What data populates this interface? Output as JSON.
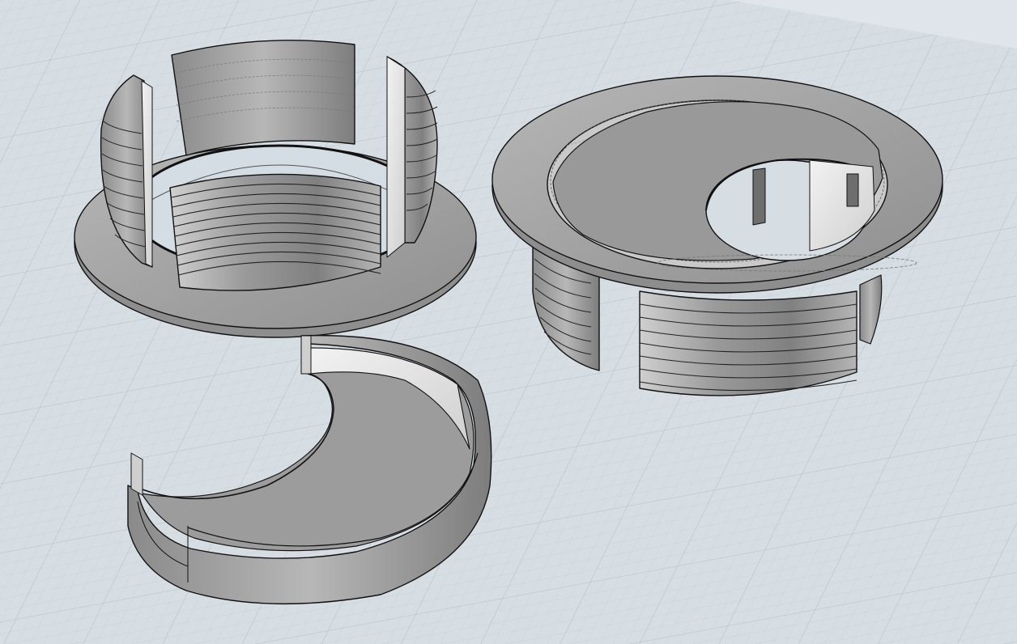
{
  "viewport": {
    "type": "cad-3d-perspective",
    "background": "#d6dee4",
    "grid_color": "#bcc6ce",
    "model_fill_dark": "#6f6f6f",
    "model_fill_mid": "#a3a3a3",
    "model_fill_light": "#e6e6e6",
    "edge_color": "#111111"
  },
  "objects": [
    {
      "id": "grommet-base-exploded",
      "description_icon": "cylinder-icon"
    },
    {
      "id": "grommet-assembled",
      "description_icon": "cylinder-icon"
    },
    {
      "id": "grommet-cap",
      "description_icon": "crescent-icon"
    }
  ]
}
